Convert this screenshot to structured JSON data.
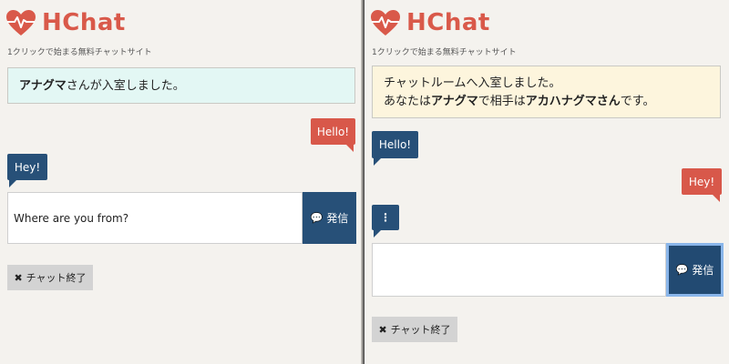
{
  "brand": {
    "name": "HChat",
    "tagline": "1クリックで始まる無料チャットサイト",
    "color": "#d9594a"
  },
  "left": {
    "notice_prefix": "アナグマ",
    "notice_suffix": "さんが入室しました。",
    "messages": [
      {
        "from": "me",
        "text": "Hello!"
      },
      {
        "from": "them",
        "text": "Hey!"
      }
    ],
    "input_value": "Where are you from?",
    "send_label": "発信",
    "end_label": "チャット終了"
  },
  "right": {
    "notice_line1": "チャットルームへ入室しました。",
    "notice_line2": {
      "a": "あなたは",
      "b": "アナグマ",
      "c": "で相手は",
      "d": "アカハナグマさん",
      "e": "です。"
    },
    "messages": [
      {
        "from": "them",
        "text": "Hello!"
      },
      {
        "from": "me",
        "text": "Hey!"
      },
      {
        "from": "them",
        "text": "⋮"
      }
    ],
    "input_value": "",
    "send_label": "発信",
    "end_label": "チャット終了"
  },
  "colors": {
    "my_bubble": "#d8584a",
    "their_bubble": "#275078",
    "teal_notice": "#e3f7f4",
    "yellow_notice": "#fdf5dd"
  }
}
